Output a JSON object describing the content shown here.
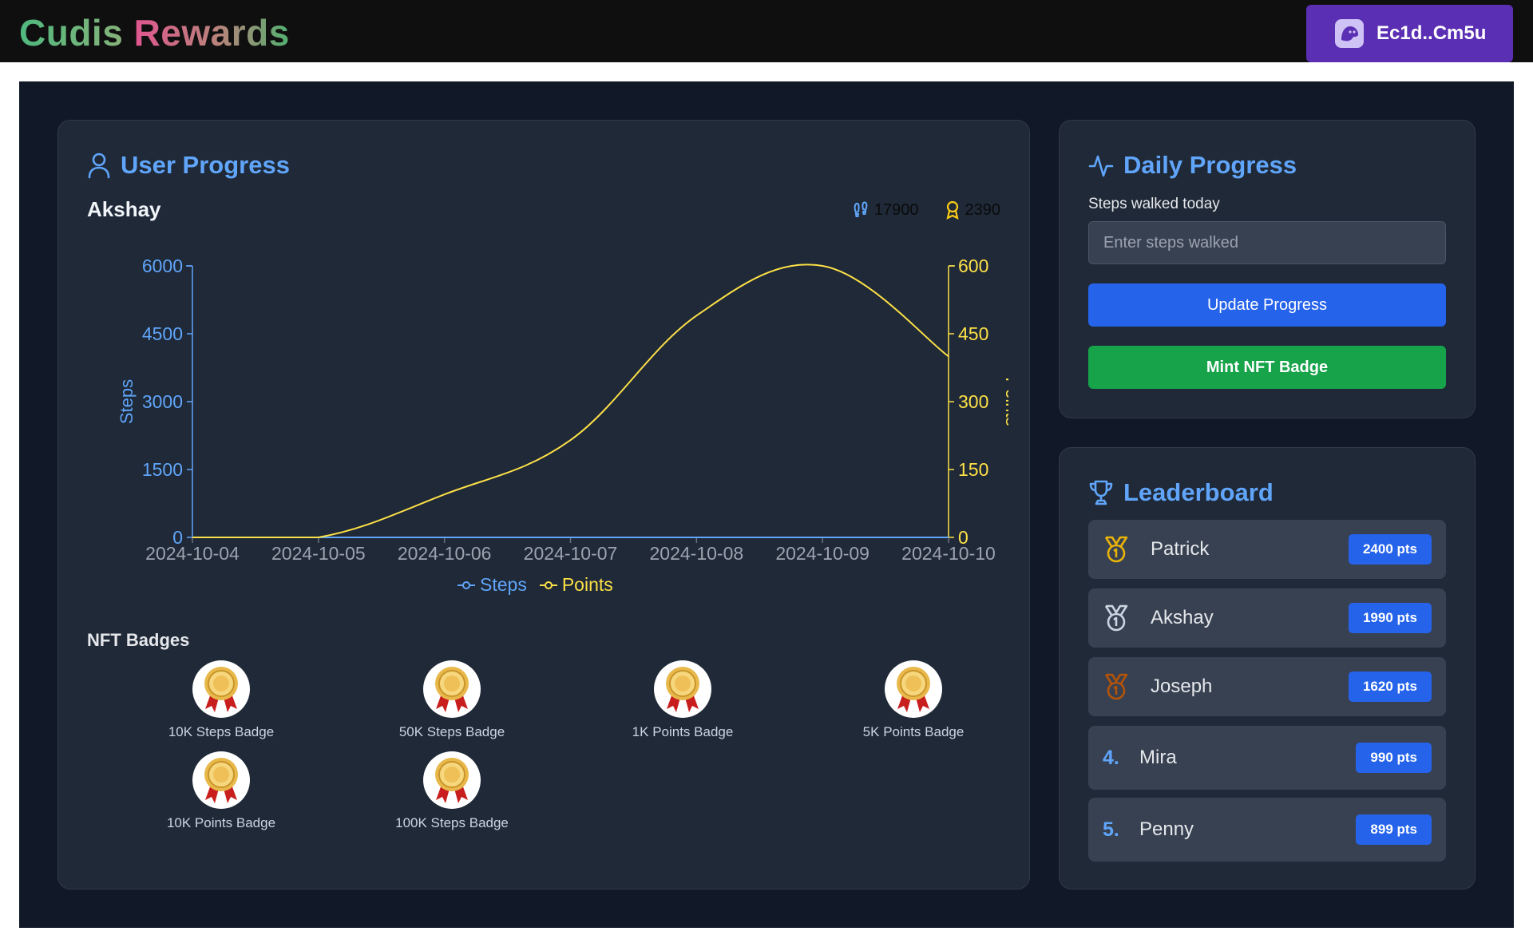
{
  "header": {
    "brand_word1": "Cudis",
    "brand_word2": "Rewards",
    "wallet_label": "Ec1d..Cm5u"
  },
  "user_progress": {
    "title": "User Progress",
    "username": "Akshay",
    "steps_stat": "17900",
    "points_stat": "2390"
  },
  "chart_data": {
    "type": "line",
    "x": [
      "2024-10-04",
      "2024-10-05",
      "2024-10-06",
      "2024-10-07",
      "2024-10-08",
      "2024-10-09",
      "2024-10-10"
    ],
    "series": [
      {
        "name": "Steps",
        "axis": "left",
        "color": "#60a5fa",
        "values": [
          0,
          0,
          0,
          0,
          0,
          0,
          0
        ]
      },
      {
        "name": "Points",
        "axis": "right",
        "color": "#fde047",
        "values": [
          0,
          0,
          95,
          215,
          490,
          600,
          400
        ]
      }
    ],
    "ylabel": "Steps",
    "y2label": "Points",
    "ylim": [
      0,
      6000
    ],
    "y2lim": [
      0,
      600
    ],
    "yticks": [
      "0",
      "1500",
      "3000",
      "4500",
      "6000"
    ],
    "y2ticks": [
      "0",
      "150",
      "300",
      "450",
      "600"
    ],
    "legend_placement": "bottom-center",
    "grid": false
  },
  "badges": {
    "title": "NFT Badges",
    "items": [
      {
        "name": "10K Steps Badge"
      },
      {
        "name": "50K Steps Badge"
      },
      {
        "name": "1K Points Badge"
      },
      {
        "name": "5K Points Badge"
      },
      {
        "name": "10K Points Badge"
      },
      {
        "name": "100K Steps Badge"
      }
    ]
  },
  "daily": {
    "title": "Daily Progress",
    "label": "Steps walked today",
    "placeholder": "Enter steps walked",
    "update_label": "Update Progress",
    "mint_label": "Mint NFT Badge"
  },
  "leaderboard": {
    "title": "Leaderboard",
    "rows": [
      {
        "rank": "1",
        "name": "Patrick",
        "points": "2400 pts",
        "medal_color": "#eab308"
      },
      {
        "rank": "2",
        "name": "Akshay",
        "points": "1990 pts",
        "medal_color": "#cbd5e1"
      },
      {
        "rank": "3",
        "name": "Joseph",
        "points": "1620 pts",
        "medal_color": "#b45309"
      },
      {
        "rank": "4.",
        "name": "Mira",
        "points": "990 pts"
      },
      {
        "rank": "5.",
        "name": "Penny",
        "points": "899 pts"
      }
    ]
  }
}
